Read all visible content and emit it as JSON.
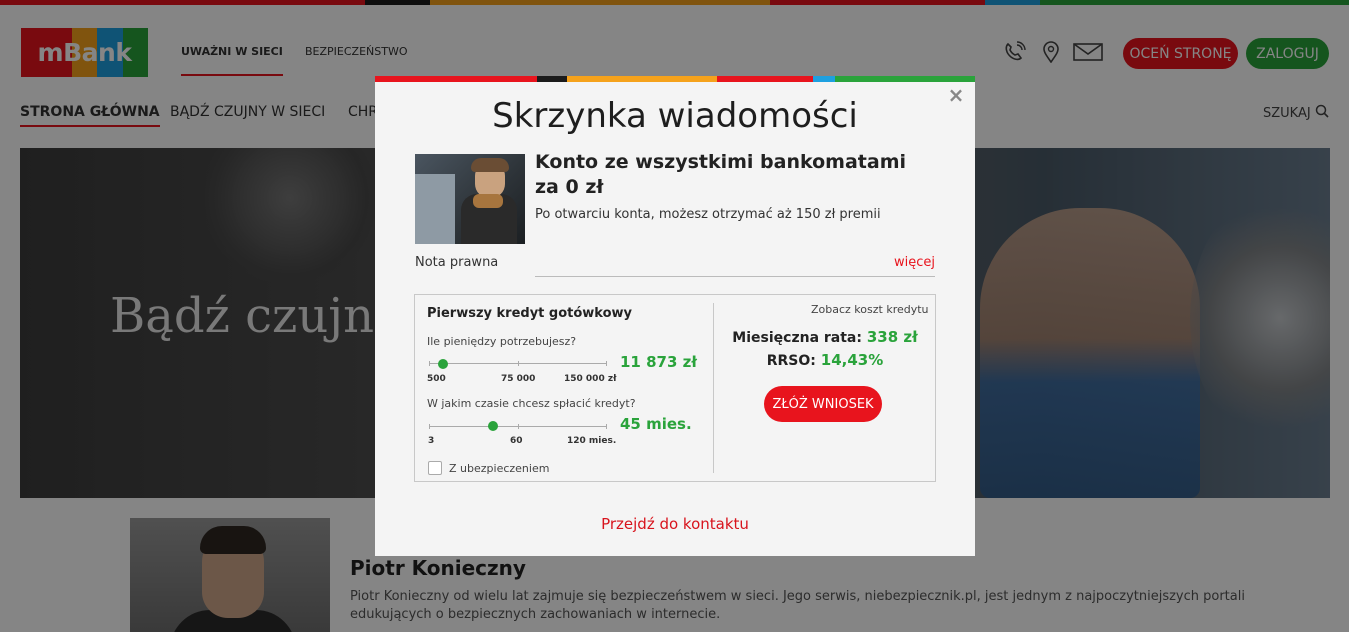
{
  "brand": {
    "logo_text": "mBank",
    "stripe_colors": [
      "#e8141d",
      "#1b1b1b",
      "#f5a21c",
      "#e8141d",
      "#1ea0e0",
      "#2aa33b"
    ]
  },
  "header": {
    "nav_top": [
      "UWAŻNI W SIECI",
      "BEZPIECZEŃSTWO"
    ],
    "icons": [
      "phone-icon",
      "location-pin-icon",
      "mail-icon"
    ],
    "rate_button": "OCEŃ STRONĘ",
    "login_button": "ZALOGUJ",
    "nav_main": [
      "STRONA GŁÓWNA",
      "BĄDŹ CZUJNY W SIECI",
      "CHR"
    ],
    "search_label": "SZUKAJ"
  },
  "hero": {
    "text": "Bądź czujn"
  },
  "author": {
    "name": "Piotr Konieczny",
    "bio": "Piotr Konieczny od wielu lat zajmuje się bezpieczeństwem w sieci. Jego serwis, niebezpiecznik.pl, jest jednym z najpoczytniejszych portali edukujących o bezpiecznych zachowaniach w internecie."
  },
  "modal": {
    "title": "Skrzynka wiadomości",
    "close_symbol": "×",
    "offer": {
      "title": "Konto ze wszystkimi bankomatami za 0 zł",
      "description": "Po otwarciu konta, możesz otrzymać aż 150 zł premii",
      "legal_note": "Nota prawna",
      "more_link": "więcej"
    },
    "calculator": {
      "title": "Pierwszy kredyt gotówkowy",
      "amount_label": "Ile pieniędzy potrzebujesz?",
      "amount_ticks": [
        "500",
        "75 000",
        "150 000 zł"
      ],
      "amount_value": "11 873 zł",
      "amount_fraction": 0.076,
      "term_label": "W jakim czasie chcesz spłacić kredyt?",
      "term_ticks": [
        "3",
        "60",
        "120 mies."
      ],
      "term_value": "45 mies.",
      "term_fraction": 0.359,
      "insurance_label": "Z ubezpieczeniem",
      "insurance_checked": false,
      "cost_link": "Zobacz koszt kredytu",
      "monthly_label": "Miesięczna rata:",
      "monthly_value": "338 zł",
      "rrso_label": "RRSO:",
      "rrso_value": "14,43%",
      "apply_button": "ZŁÓŻ WNIOSEK"
    },
    "contact_link": "Przejdź do kontaktu"
  },
  "colors": {
    "accent_red": "#e8141d",
    "accent_green": "#2aa33b",
    "overlay": "rgba(0,0,0,0.48)"
  }
}
